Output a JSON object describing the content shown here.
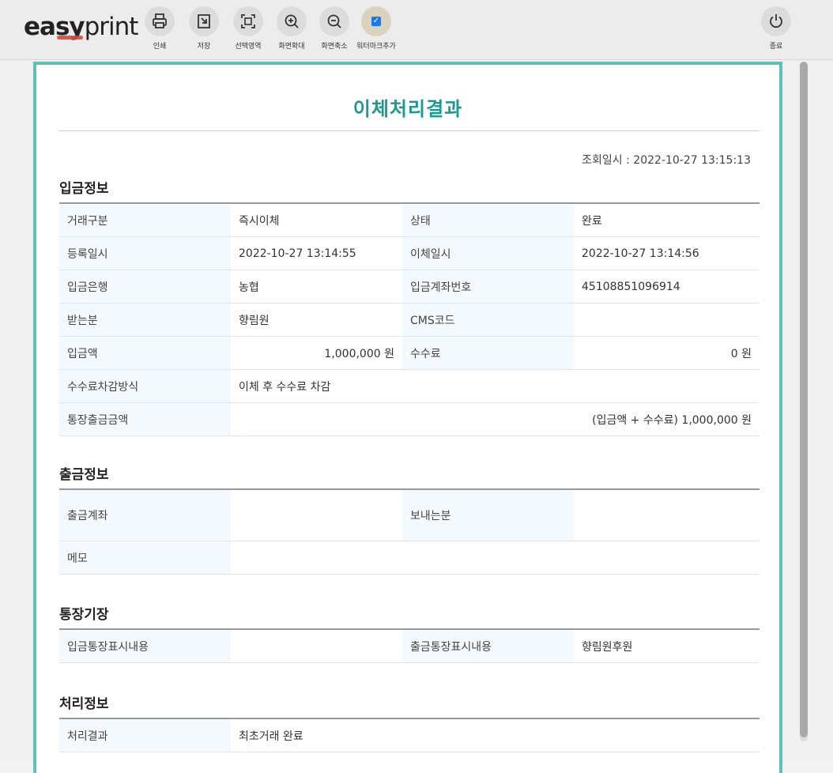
{
  "toolbar": {
    "logo": {
      "part1": "ea",
      "part2": "sy",
      "part3": "print"
    },
    "buttons": [
      {
        "label": "인쇄",
        "icon": "printer-icon"
      },
      {
        "label": "저장",
        "icon": "save-icon"
      },
      {
        "label": "선택영역",
        "icon": "select-area-icon"
      },
      {
        "label": "화면확대",
        "icon": "zoom-in-icon"
      },
      {
        "label": "화면축소",
        "icon": "zoom-out-icon"
      },
      {
        "label": "워터마크추가",
        "icon": "checkbox-icon",
        "checked": true
      }
    ],
    "exit_label": "종료"
  },
  "document": {
    "title": "이체처리결과",
    "inquiry_time": "조회일시 : 2022-10-27 13:15:13",
    "deposit": {
      "heading": "입금정보",
      "rows": [
        {
          "l1": "거래구분",
          "v1": "즉시이체",
          "l2": "상태",
          "v2": "완료"
        },
        {
          "l1": "등록일시",
          "v1": "2022-10-27 13:14:55",
          "l2": "이체일시",
          "v2": "2022-10-27 13:14:56"
        },
        {
          "l1": "입금은행",
          "v1": "농협",
          "l2": "입금계좌번호",
          "v2": "45108851096914"
        },
        {
          "l1": "받는분",
          "v1": "향림원",
          "l2": "CMS코드",
          "v2": ""
        },
        {
          "l1": "입금액",
          "v1": "1,000,000 원",
          "l2": "수수료",
          "v2": "0 원"
        }
      ],
      "fee_method_label": "수수료차감방식",
      "fee_method_value": "이체 후 수수료 차감",
      "bankbook_amount_label": "통장출금금액",
      "bankbook_amount_value": "(입금액 + 수수료) 1,000,000 원"
    },
    "withdrawal": {
      "heading": "출금정보",
      "account_label": "출금계좌",
      "account_value": "",
      "sender_label": "보내는분",
      "sender_value": "",
      "memo_label": "메모",
      "memo_value": ""
    },
    "passbook": {
      "heading": "통장기장",
      "in_label": "입금통장표시내용",
      "in_value": "",
      "out_label": "출금통장표시내용",
      "out_value": "향림원후원"
    },
    "processing": {
      "heading": "처리정보",
      "result_label": "처리결과",
      "result_value": "최초거래 완료"
    }
  },
  "colors": {
    "accent": "#1b9a92",
    "border": "#5fc1b5",
    "label_bg": "#f3f9fc"
  }
}
